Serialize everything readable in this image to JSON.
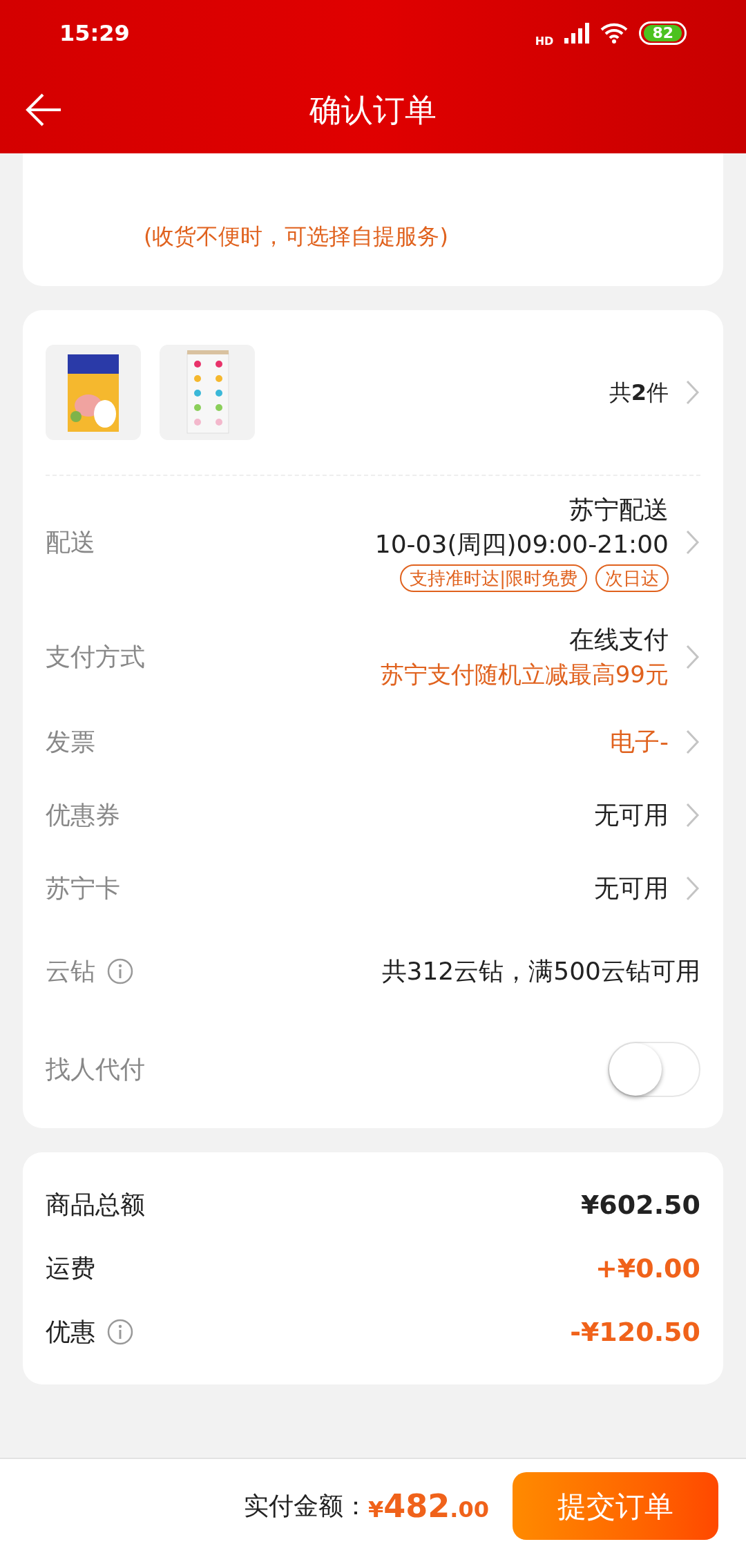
{
  "status_bar": {
    "time": "15:29",
    "network": "HD",
    "battery": "82"
  },
  "header": {
    "title": "确认订单"
  },
  "address": {
    "note": "(收货不便时，可选择自提服务)"
  },
  "products": {
    "count_prefix": "共",
    "count": "2",
    "count_suffix": "件"
  },
  "rows": [
    {
      "kind": "delivery",
      "label": "配送",
      "value": "苏宁配送",
      "detail": "10-03(周四)09:00-21:00",
      "tags": [
        "支持准时达|限时免费",
        "次日达"
      ]
    },
    {
      "kind": "payment",
      "label": "支付方式",
      "value": "在线支付",
      "promo": "苏宁支付随机立减最高99元"
    },
    {
      "kind": "link",
      "label": "发票",
      "value": "电子-",
      "accent": true
    },
    {
      "kind": "link",
      "label": "优惠券",
      "value": "无可用",
      "accent": false
    },
    {
      "kind": "link",
      "label": "苏宁卡",
      "value": "无可用",
      "accent": false
    },
    {
      "kind": "info",
      "label": "云钻",
      "value": "共312云钻，满500云钻可用"
    },
    {
      "kind": "toggle",
      "label": "找人代付",
      "on": false
    }
  ],
  "summary": [
    {
      "label": "商品总额",
      "value": "¥602.50",
      "accent": false,
      "info": false
    },
    {
      "label": "运费",
      "value": "+¥0.00",
      "accent": true,
      "info": false
    },
    {
      "label": "优惠",
      "value": "-¥120.50",
      "accent": true,
      "info": true
    }
  ],
  "footer": {
    "label": "实付金额：",
    "currency": "¥",
    "amount": "482",
    "cents": ".00",
    "submit": "提交订单"
  }
}
